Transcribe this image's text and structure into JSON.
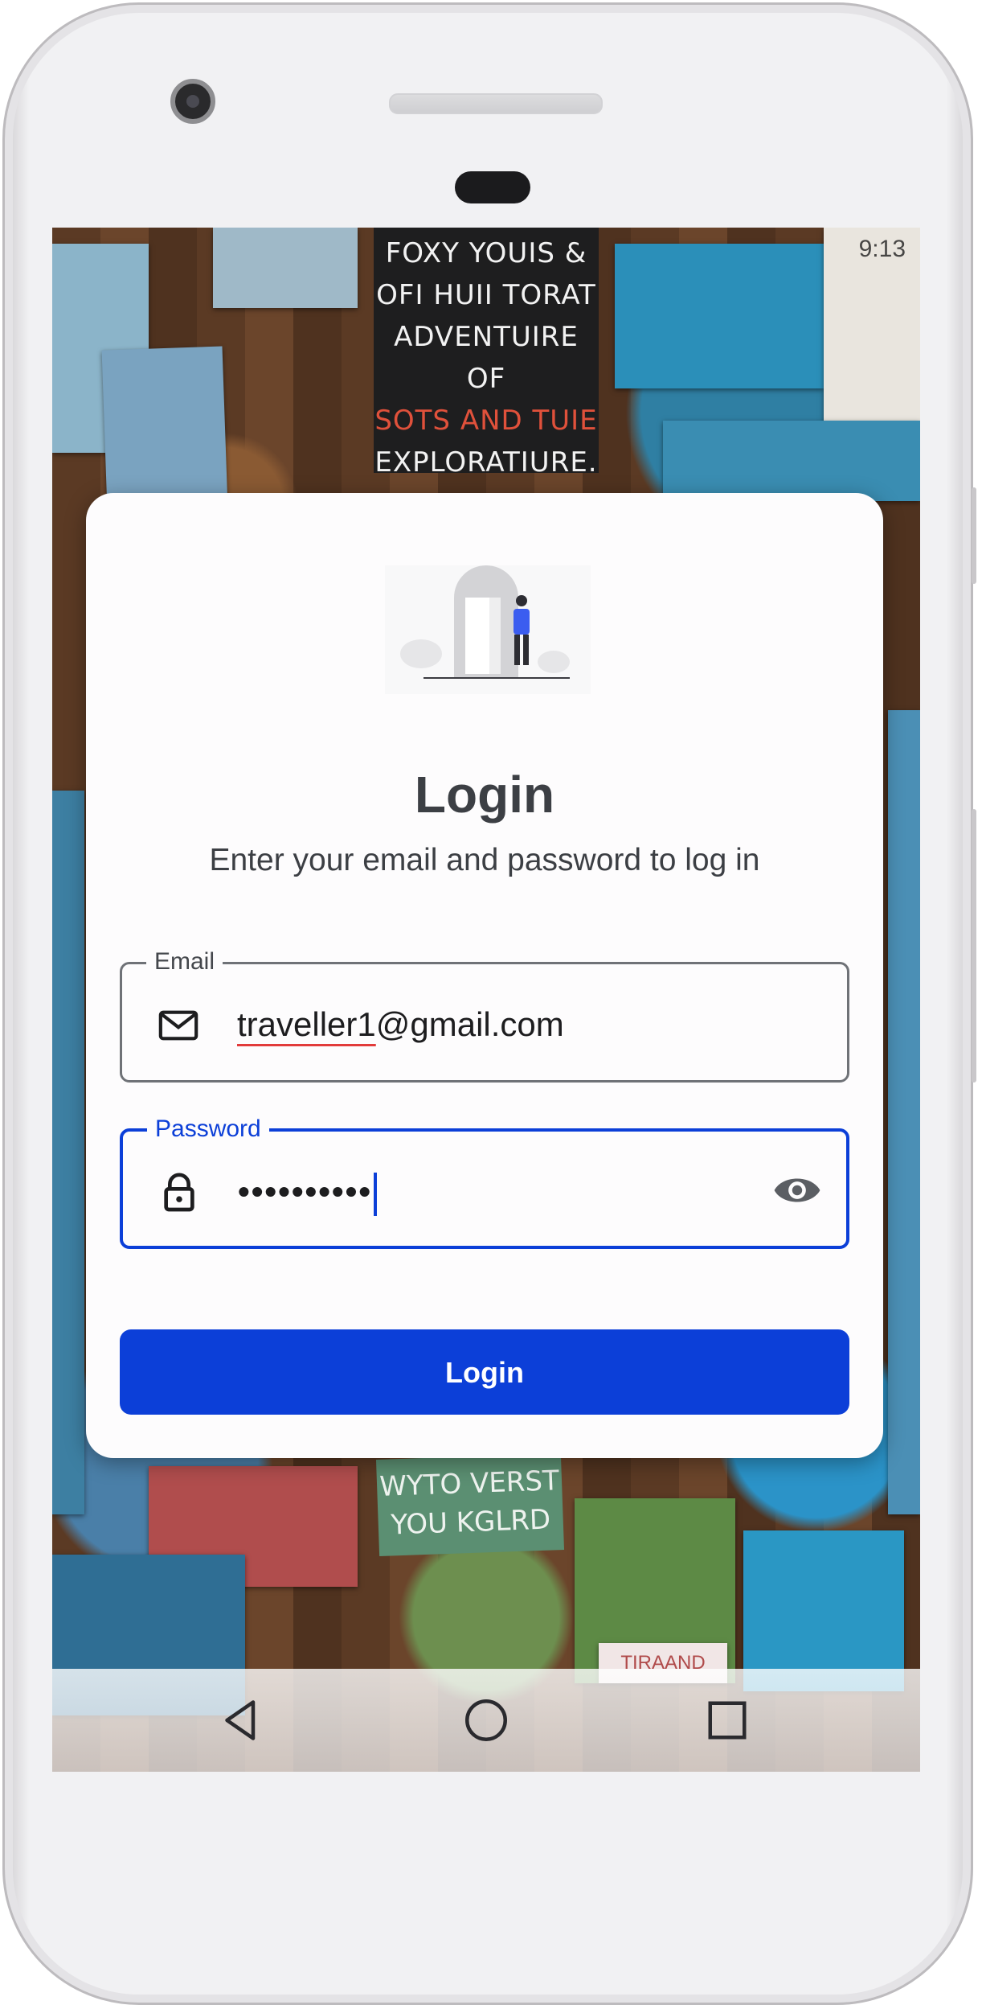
{
  "status_bar": {
    "time": "9:13"
  },
  "background": {
    "poster_lines": [
      {
        "text": "FOXY YOUIS &",
        "accent": false
      },
      {
        "text": "OFI HUII TORAT",
        "accent": false
      },
      {
        "text": "ADVENTUIRE OF",
        "accent": false
      },
      {
        "text": "SOTS AND TUIE",
        "accent": true
      },
      {
        "text": "EXPLORATIURE.",
        "accent": false
      }
    ],
    "sign_lines": [
      "WYTO VERST",
      "YOU KGLRD"
    ],
    "ticket_text": "TIRAAND"
  },
  "login_card": {
    "title": "Login",
    "subtitle": "Enter your email and password to log in",
    "email_field": {
      "label": "Email",
      "value_underlined": "traveller1",
      "value_rest": "@gmail.com",
      "icon": "mail-icon"
    },
    "password_field": {
      "label": "Password",
      "masked_value": "••••••••••",
      "icon": "lock-icon",
      "toggle_icon": "eye-icon"
    },
    "login_button_label": "Login"
  },
  "nav_bar": {
    "buttons": [
      "back-icon",
      "home-icon",
      "recents-icon"
    ]
  },
  "colors": {
    "primary": "#0c3fd8",
    "text": "#3c3f44",
    "outline": "#6f7277",
    "card": "#fdfcfd"
  }
}
